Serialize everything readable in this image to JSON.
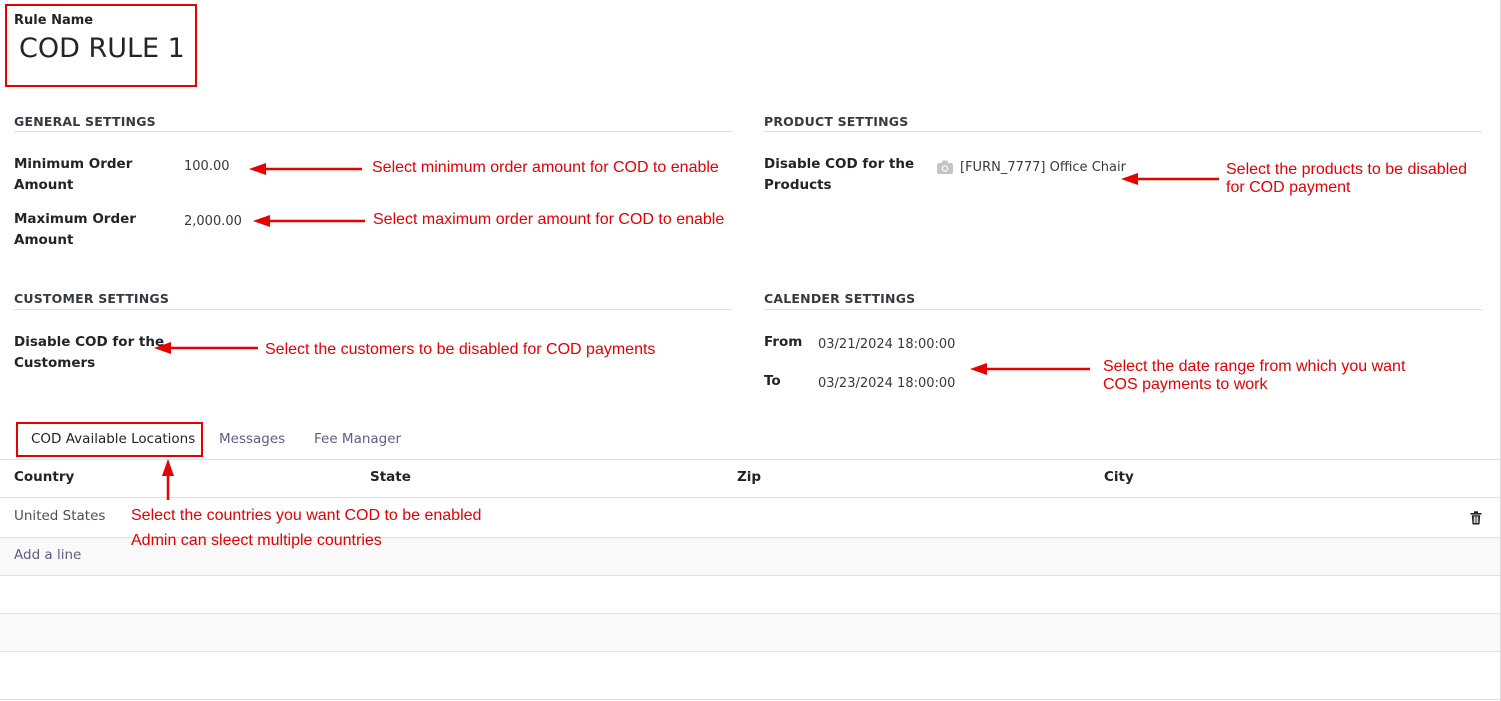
{
  "rule": {
    "label": "Rule Name",
    "name": "COD RULE 1"
  },
  "general": {
    "title": "GENERAL SETTINGS",
    "min_label_1": "Minimum Order",
    "min_label_2": "Amount",
    "min_value": "100.00",
    "max_label_1": "Maximum Order",
    "max_label_2": "Amount",
    "max_value": "2,000.00"
  },
  "product": {
    "title": "PRODUCT SETTINGS",
    "label_1": "Disable COD for the",
    "label_2": "Products",
    "item": "[FURN_7777] Office Chair"
  },
  "customer": {
    "title": "CUSTOMER SETTINGS",
    "label_1": "Disable COD for the",
    "label_2": "Customers"
  },
  "calendar": {
    "title": "CALENDER SETTINGS",
    "from_label": "From",
    "from_value": "03/21/2024 18:00:00",
    "to_label": "To",
    "to_value": "03/23/2024 18:00:00"
  },
  "tabs": [
    {
      "label": "COD Available Locations"
    },
    {
      "label": "Messages"
    },
    {
      "label": "Fee Manager"
    }
  ],
  "table": {
    "headers": [
      "Country",
      "State",
      "Zip",
      "City"
    ],
    "rows": [
      {
        "country": "United States",
        "state": "",
        "zip": "",
        "city": ""
      }
    ],
    "add_line": "Add a line"
  },
  "notes": {
    "min": "Select minimum order amount for COD to enable",
    "max": "Select maximum order amount for COD to enable",
    "products_1": "Select the products to be disabled",
    "products_2": "for COD payment",
    "customers": "Select the customers to be disabled for COD payments",
    "dates_1": "Select the date range from which you want",
    "dates_2": "COS payments to work",
    "countries_1": "Select the countries you want COD to be enabled",
    "countries_2": "Admin can sleect multiple countries"
  },
  "colors": {
    "annotation": "#e60000",
    "tab_link": "#5c5e88",
    "divider": "#dee2e6"
  },
  "icons": [
    "camera-icon",
    "trash-icon"
  ]
}
